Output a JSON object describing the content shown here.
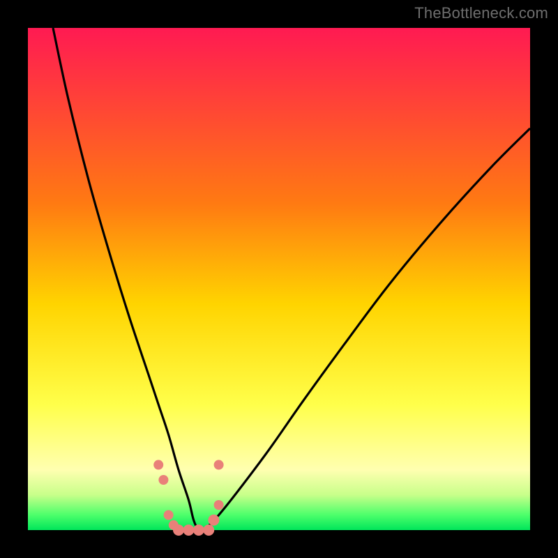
{
  "watermark": "TheBottleneck.com",
  "chart_data": {
    "type": "line",
    "title": "",
    "xlabel": "",
    "ylabel": "",
    "xlim": [
      0,
      100
    ],
    "ylim": [
      0,
      100
    ],
    "background": {
      "kind": "vertical-gradient",
      "stops": [
        {
          "pos": 0,
          "color": "#ff1a52"
        },
        {
          "pos": 35,
          "color": "#ff7a12"
        },
        {
          "pos": 55,
          "color": "#ffd400"
        },
        {
          "pos": 75,
          "color": "#ffff4a"
        },
        {
          "pos": 88,
          "color": "#ffffb0"
        },
        {
          "pos": 93,
          "color": "#c8ff8a"
        },
        {
          "pos": 97,
          "color": "#4cff6b"
        },
        {
          "pos": 100,
          "color": "#00e55a"
        }
      ]
    },
    "series": [
      {
        "name": "bottleneck-curve",
        "color": "#000000",
        "x": [
          5,
          8,
          12,
          16,
          20,
          24,
          26,
          28,
          30,
          32,
          33,
          34,
          35,
          38,
          42,
          48,
          55,
          63,
          72,
          82,
          92,
          100
        ],
        "values": [
          100,
          86,
          70,
          56,
          43,
          31,
          25,
          19,
          12,
          6,
          2,
          0,
          0,
          3,
          8,
          16,
          26,
          37,
          49,
          61,
          72,
          80
        ]
      }
    ],
    "markers": [
      {
        "x": 26,
        "y": 13,
        "color": "#e98079",
        "r": 7
      },
      {
        "x": 27,
        "y": 10,
        "color": "#e98079",
        "r": 7
      },
      {
        "x": 28,
        "y": 3,
        "color": "#e98079",
        "r": 7
      },
      {
        "x": 29,
        "y": 1,
        "color": "#e98079",
        "r": 7
      },
      {
        "x": 30,
        "y": 0,
        "color": "#e98079",
        "r": 8
      },
      {
        "x": 32,
        "y": 0,
        "color": "#e98079",
        "r": 8
      },
      {
        "x": 34,
        "y": 0,
        "color": "#e98079",
        "r": 8
      },
      {
        "x": 36,
        "y": 0,
        "color": "#e98079",
        "r": 8
      },
      {
        "x": 37,
        "y": 2,
        "color": "#e98079",
        "r": 8
      },
      {
        "x": 38,
        "y": 5,
        "color": "#e98079",
        "r": 7
      },
      {
        "x": 38,
        "y": 13,
        "color": "#e98079",
        "r": 7
      }
    ]
  }
}
